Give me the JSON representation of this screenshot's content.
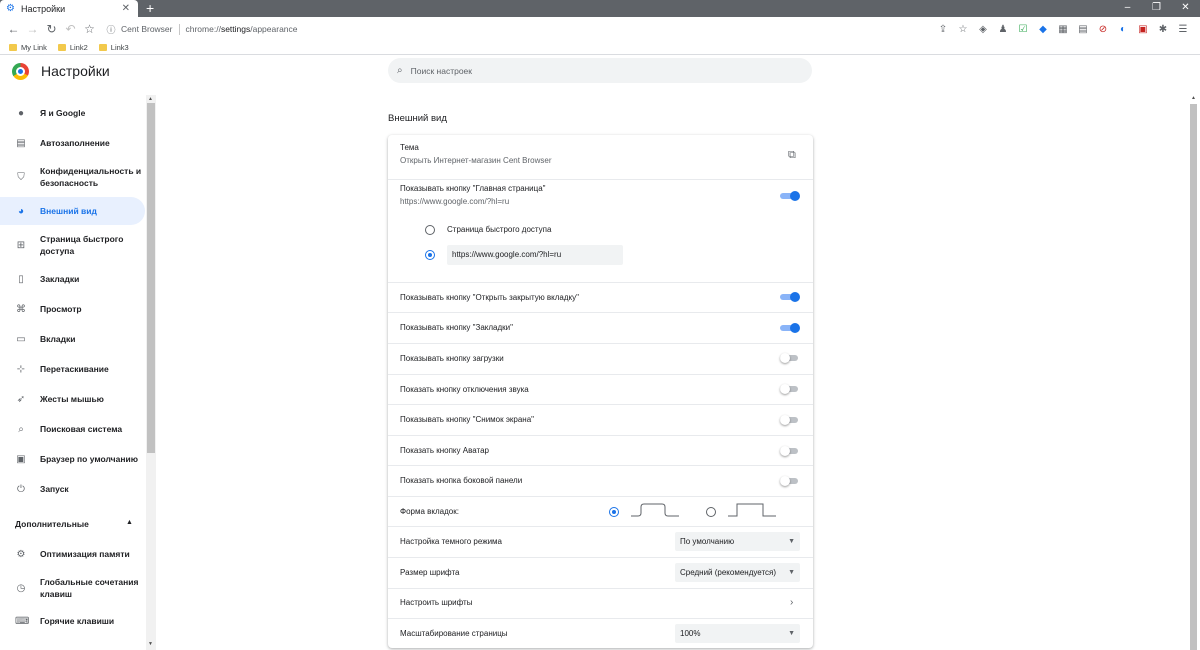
{
  "tab": {
    "title": "Настройки"
  },
  "window": {
    "minimize": "–",
    "maximize": "❐",
    "close": "✕"
  },
  "toolbar": {
    "brand": "Cent Browser",
    "url_prefix": "chrome://",
    "url_host": "settings",
    "url_path": "/appearance"
  },
  "bookmarks": [
    "My Link",
    "Link2",
    "Link3"
  ],
  "settings": {
    "title": "Настройки",
    "search_placeholder": "Поиск настроек"
  },
  "sidebar": {
    "items": [
      {
        "label": "Я и Google",
        "icon": "person-icon"
      },
      {
        "label": "Автозаполнение",
        "icon": "clipboard-icon"
      },
      {
        "label": "Конфиденциальность и безопасность",
        "icon": "shield-icon"
      },
      {
        "label": "Внешний вид",
        "icon": "palette-icon",
        "active": true
      },
      {
        "label": "Страница быстрого доступа",
        "icon": "speed-dial-icon"
      },
      {
        "label": "Закладки",
        "icon": "bookmark-icon"
      },
      {
        "label": "Просмотр",
        "icon": "browse-icon"
      },
      {
        "label": "Вкладки",
        "icon": "tabs-icon"
      },
      {
        "label": "Перетаскивание",
        "icon": "drag-icon"
      },
      {
        "label": "Жесты мышью",
        "icon": "cursor-icon"
      },
      {
        "label": "Поисковая система",
        "icon": "search-icon"
      },
      {
        "label": "Браузер по умолчанию",
        "icon": "browser-icon"
      },
      {
        "label": "Запуск",
        "icon": "power-icon"
      }
    ],
    "advanced_label": "Дополнительные",
    "advanced_items": [
      {
        "label": "Оптимизация памяти",
        "icon": "gear-icon"
      },
      {
        "label": "Глобальные сочетания клавиш",
        "icon": "clock-icon"
      },
      {
        "label": "Горячие клавиши",
        "icon": "keyboard-icon"
      }
    ]
  },
  "appearance": {
    "section_title": "Внешний вид",
    "theme_title": "Тема",
    "theme_sub": "Открыть Интернет-магазин Cent Browser",
    "home_title": "Показывать кнопку \"Главная страница\"",
    "home_sub": "https://www.google.com/?hl=ru",
    "home_opt_speed": "Страница быстрого доступа",
    "home_opt_url": "https://www.google.com/?hl=ru",
    "reopen_tab": "Показывать кнопку \"Открыть закрытую вкладку\"",
    "bookmarks_btn": "Показывать кнопку \"Закладки\"",
    "download_btn": "Показывать кнопку загрузки",
    "mute_btn": "Показать кнопку отключения звука",
    "screenshot_btn": "Показывать кнопку \"Снимок экрана\"",
    "avatar_btn": "Показать кнопку Аватар",
    "side_panel_btn": "Показать кнопка боковой панели",
    "tab_shape": "Форма вкладок:",
    "dark_mode": "Настройка темного режима",
    "dark_mode_value": "По умолчанию",
    "font_size": "Размер шрифта",
    "font_size_value": "Средний (рекомендуется)",
    "custom_fonts": "Настроить шрифты",
    "page_zoom": "Масштабирование страницы",
    "page_zoom_value": "100%"
  },
  "toggles": {
    "home": true,
    "reopen_tab": true,
    "bookmarks": true,
    "download": false,
    "mute": false,
    "screenshot": false,
    "avatar": false,
    "side_panel": false
  },
  "colors": {
    "accent": "#1a73e8",
    "active_bg": "#e8f0fe",
    "tabstrip": "#5f6368"
  }
}
